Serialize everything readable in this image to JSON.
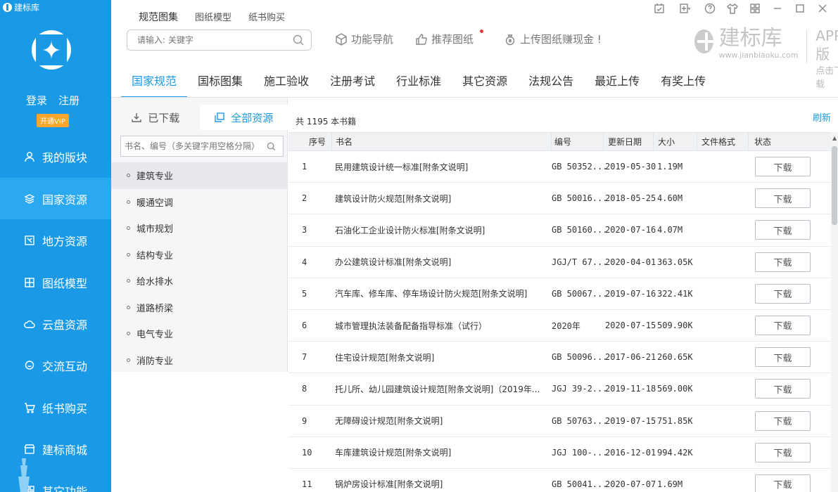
{
  "app": {
    "title": "建标库"
  },
  "sidebar": {
    "login": "登录",
    "register": "注册",
    "vip": "开通VIP",
    "items": [
      {
        "label": "我的版块",
        "icon": "user-icon"
      },
      {
        "label": "国家资源",
        "icon": "layers-icon",
        "active": true
      },
      {
        "label": "地方资源",
        "icon": "map-icon"
      },
      {
        "label": "图纸模型",
        "icon": "blueprint-icon"
      },
      {
        "label": "云盘资源",
        "icon": "cloud-icon"
      },
      {
        "label": "交流互动",
        "icon": "chat-icon"
      },
      {
        "label": "纸书购买",
        "icon": "cart-icon"
      },
      {
        "label": "建标商城",
        "icon": "shop-icon"
      },
      {
        "label": "其它功能",
        "icon": "grid-icon"
      }
    ]
  },
  "top": {
    "tabs": [
      "规范图集",
      "图纸模型",
      "纸书购买"
    ],
    "search_placeholder": "请输入: 关键字",
    "links": [
      "功能导航",
      "推荐图纸",
      "上传图纸赚现金 !"
    ]
  },
  "brand": {
    "name": "建标库",
    "url": "www.jianbiaoku.com",
    "app": "APP版",
    "click": "点击下载"
  },
  "category_tabs": [
    "国家规范",
    "国标图集",
    "施工验收",
    "注册考试",
    "行业标准",
    "其它资源",
    "法规公告",
    "最近上传",
    "有奖上传"
  ],
  "left": {
    "downloaded": "已下载",
    "all": "全部资源",
    "filter_placeholder": "书名、编号（多关键字用空格分隔）",
    "categories": [
      "建筑专业",
      "暖通空调",
      "城市规划",
      "结构专业",
      "给水排水",
      "道路桥梁",
      "电气专业",
      "消防专业"
    ]
  },
  "table": {
    "count": "共 1195 本书籍",
    "refresh": "刷新",
    "headers": {
      "no": "序号",
      "name": "书名",
      "code": "编号",
      "date": "更新日期",
      "size": "大小",
      "format": "文件格式",
      "status": "状态"
    },
    "download_label": "下载",
    "rows": [
      {
        "no": "1",
        "name": "民用建筑设计统一标准[附条文说明]",
        "code": "GB 50352...",
        "date": "2019-05-30",
        "size": "1.19M"
      },
      {
        "no": "2",
        "name": "建筑设计防火规范[附条文说明]",
        "code": "GB 50016...",
        "date": "2018-05-25",
        "size": "4.60M"
      },
      {
        "no": "3",
        "name": "石油化工企业设计防火标准[附条文说明]",
        "code": "GB 50160...",
        "date": "2020-07-16",
        "size": "4.07M"
      },
      {
        "no": "4",
        "name": "办公建筑设计标准[附条文说明]",
        "code": "JGJ/T 67...",
        "date": "2020-04-01",
        "size": "363.05K"
      },
      {
        "no": "5",
        "name": "汽车库、修车库、停车场设计防火规范[附条文说明]",
        "code": "GB 50067...",
        "date": "2019-07-16",
        "size": "322.41K"
      },
      {
        "no": "6",
        "name": "城市管理执法装备配备指导标准（试行）",
        "code": "2020年",
        "date": "2020-07-15",
        "size": "509.90K"
      },
      {
        "no": "7",
        "name": "住宅设计规范[附条文说明]",
        "code": "GB 50096...",
        "date": "2017-06-21",
        "size": "260.65K"
      },
      {
        "no": "8",
        "name": "托儿所、幼儿园建筑设计规范[附条文说明]（2019年...",
        "code": "JGJ 39-2...",
        "date": "2019-11-18",
        "size": "569.00K"
      },
      {
        "no": "9",
        "name": "无障碍设计规范[附条文说明]",
        "code": "GB 50763...",
        "date": "2019-07-15",
        "size": "751.85K"
      },
      {
        "no": "10",
        "name": "车库建筑设计规范[附条文说明]",
        "code": "JGJ 100-...",
        "date": "2016-12-01",
        "size": "994.42K"
      },
      {
        "no": "11",
        "name": "锅炉房设计标准[附条文说明]",
        "code": "GB 50041...",
        "date": "2020-07-07",
        "size": "1.69M"
      }
    ]
  }
}
